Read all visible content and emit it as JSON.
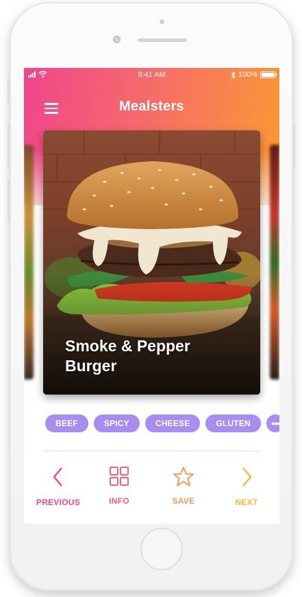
{
  "status_bar": {
    "time": "9:41 AM",
    "battery": "100%"
  },
  "header": {
    "title": "Mealsters"
  },
  "card": {
    "title_line1": "Smoke & Pepper",
    "title_line2": "Burger"
  },
  "tags": [
    "BEEF",
    "SPICY",
    "CHEESE",
    "GLUTEN"
  ],
  "more_tags_label": "•••",
  "nav": {
    "previous": {
      "label": "PREVIOUS",
      "color": "#f0458c",
      "icon": "chevron-left-icon"
    },
    "info": {
      "label": "INFO",
      "color": "#f2647a",
      "icon": "grid-icon"
    },
    "save": {
      "label": "SAVE",
      "color": "#f99a57",
      "icon": "star-icon"
    },
    "next": {
      "label": "NEXT",
      "color": "#fbb640",
      "icon": "chevron-right-icon"
    }
  },
  "colors": {
    "gradient_start": "#f0458c",
    "gradient_end": "#fb9a33",
    "tag_background": "#a98cf0"
  }
}
